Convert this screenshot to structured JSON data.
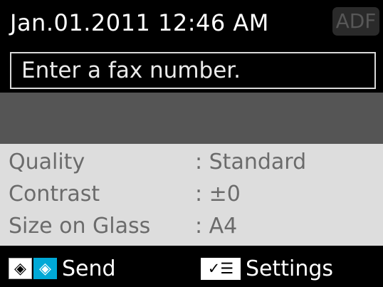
{
  "header": {
    "datetime": "Jan.01.2011 12:46 AM",
    "adf_label": "ADF"
  },
  "fax": {
    "placeholder": "Enter a fax number."
  },
  "settings": [
    {
      "label": "Quality",
      "value": ": Standard"
    },
    {
      "label": "Contrast",
      "value": ": ±0"
    },
    {
      "label": "Size on Glass",
      "value": ": A4"
    }
  ],
  "footer": {
    "send_label": "Send",
    "settings_label": "Settings",
    "send_icon": "diamond-icon",
    "settings_icon": "settings-menu-icon"
  },
  "colors": {
    "background": "#000000",
    "settings_panel": "#dddddd",
    "gray_band": "#555555",
    "accent": "#00a9d7"
  }
}
